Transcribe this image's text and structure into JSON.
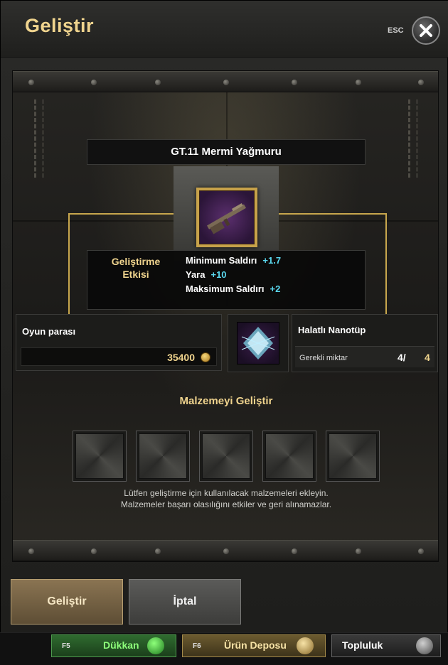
{
  "window": {
    "title": "Geliştir",
    "esc_label": "ESC"
  },
  "item": {
    "name": "GT.11 Mermi Yağmuru"
  },
  "effects": {
    "title_line1": "Geliştirme",
    "title_line2": "Etkisi",
    "stats": [
      {
        "label": "Minimum Saldırı",
        "value": "+1.7"
      },
      {
        "label": "Yara",
        "value": "+10"
      },
      {
        "label": "Maksimum Saldırı",
        "value": "+2"
      }
    ]
  },
  "currency": {
    "label": "Oyun parası",
    "value": "35400"
  },
  "material": {
    "name": "Halatlı Nanotüp",
    "required_label": "Gerekli miktar",
    "have": "4",
    "separator": "/",
    "need": "4"
  },
  "upgrade_materials": {
    "heading": "Malzemeyi Geliştir",
    "hint_line1": "Lütfen geliştirme için kullanılacak malzemeleri ekleyin.",
    "hint_line2": "Malzemeler başarı olasılığını etkiler ve geri alınamazlar."
  },
  "buttons": {
    "upgrade": "Geliştir",
    "cancel": "İptal"
  },
  "bottom_bar": {
    "shop": {
      "key": "F5",
      "label": "Dükkan"
    },
    "storage": {
      "key": "F6",
      "label": "Ürün Deposu"
    },
    "community": {
      "label": "Topluluk"
    }
  },
  "colors": {
    "accent_gold": "#f0d48e",
    "stat_value": "#5ad8ef",
    "shop_green": "#8dff7a"
  }
}
